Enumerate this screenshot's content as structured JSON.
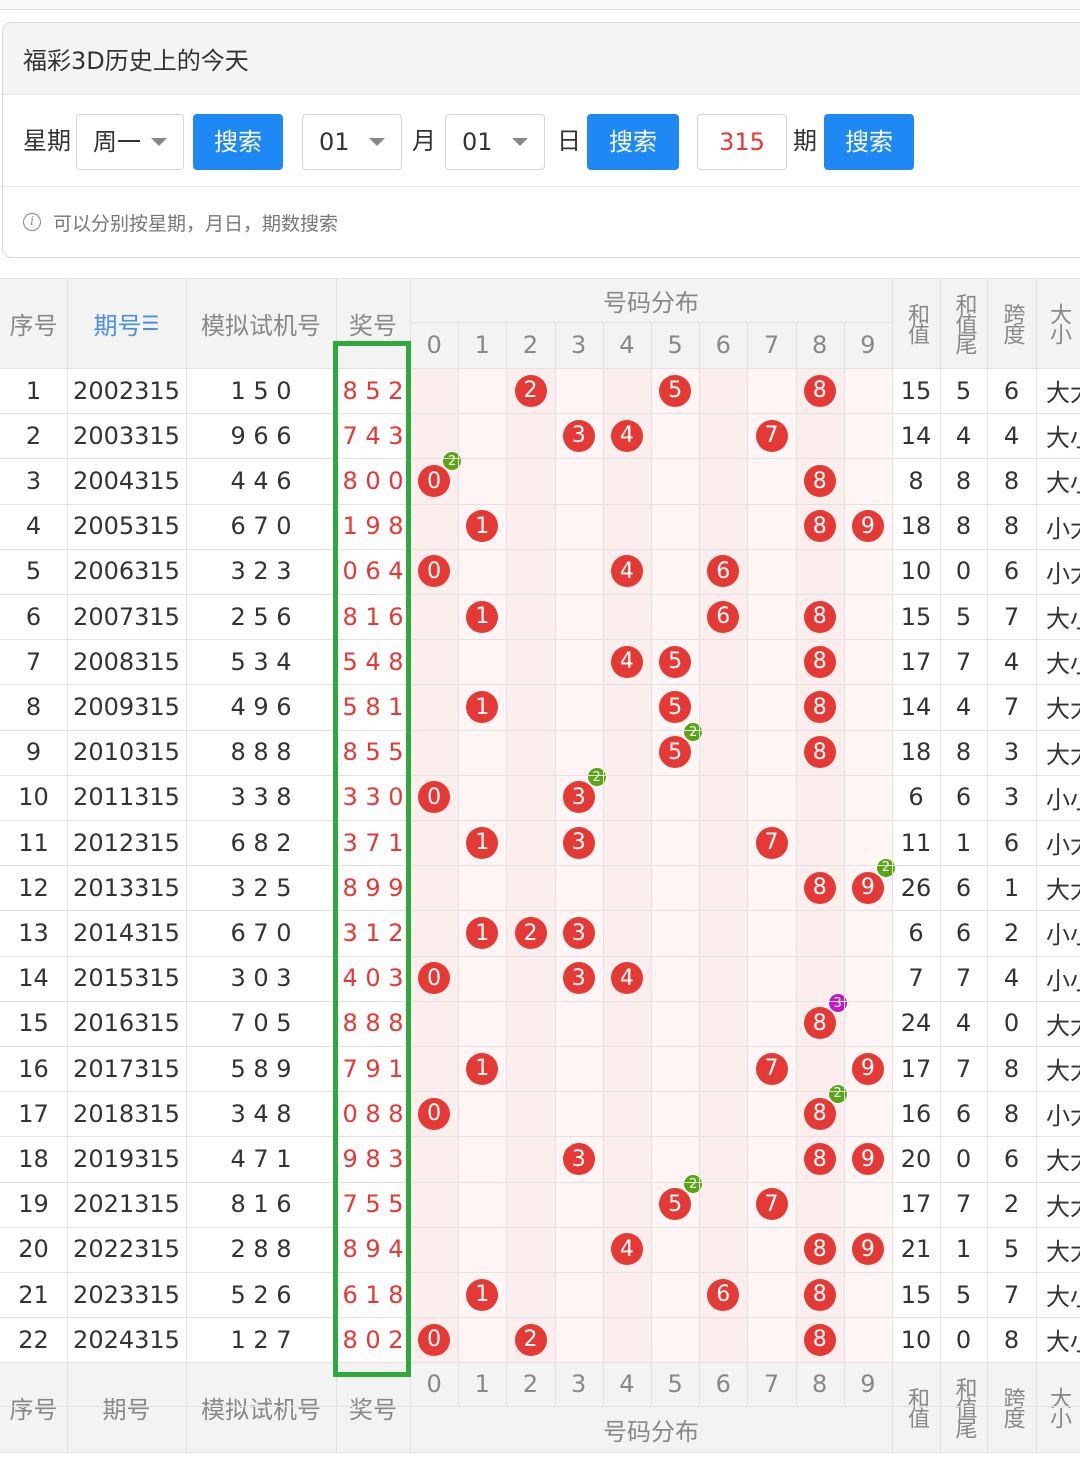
{
  "panel": {
    "title": "福彩3D历史上的今天",
    "weekday_label": "星期",
    "weekday_value": "周一",
    "search_label": "搜索",
    "month_value": "01",
    "month_label": "月",
    "day_value": "01",
    "day_label": "日",
    "issue_value": "315",
    "issue_label": "期",
    "tip": "可以分别按星期，月日，期数搜索"
  },
  "table": {
    "headers": {
      "seq": "序号",
      "issue": "期号",
      "sim": "模拟试机号",
      "prize": "奖号",
      "dist": "号码分布",
      "sum": "和值",
      "sum_tail": "和值尾",
      "span": "跨度",
      "size": "大小"
    },
    "digits": [
      "0",
      "1",
      "2",
      "3",
      "4",
      "5",
      "6",
      "7",
      "8",
      "9"
    ],
    "rows": [
      {
        "seq": "1",
        "issue": "2002315",
        "sim": "1 5 0",
        "prize": "8 5 2",
        "sum": "15",
        "tail": "5",
        "span": "6",
        "size": "大大小"
      },
      {
        "seq": "2",
        "issue": "2003315",
        "sim": "9 6 6",
        "prize": "7 4 3",
        "sum": "14",
        "tail": "4",
        "span": "4",
        "size": "大小小"
      },
      {
        "seq": "3",
        "issue": "2004315",
        "sim": "4 4 6",
        "prize": "8 0 0",
        "sum": "8",
        "tail": "8",
        "span": "8",
        "size": "大小小"
      },
      {
        "seq": "4",
        "issue": "2005315",
        "sim": "6 7 0",
        "prize": "1 9 8",
        "sum": "18",
        "tail": "8",
        "span": "8",
        "size": "小大大"
      },
      {
        "seq": "5",
        "issue": "2006315",
        "sim": "3 2 3",
        "prize": "0 6 4",
        "sum": "10",
        "tail": "0",
        "span": "6",
        "size": "小大小"
      },
      {
        "seq": "6",
        "issue": "2007315",
        "sim": "2 5 6",
        "prize": "8 1 6",
        "sum": "15",
        "tail": "5",
        "span": "7",
        "size": "大小大"
      },
      {
        "seq": "7",
        "issue": "2008315",
        "sim": "5 3 4",
        "prize": "5 4 8",
        "sum": "17",
        "tail": "7",
        "span": "4",
        "size": "大小大"
      },
      {
        "seq": "8",
        "issue": "2009315",
        "sim": "4 9 6",
        "prize": "5 8 1",
        "sum": "14",
        "tail": "4",
        "span": "7",
        "size": "大大小"
      },
      {
        "seq": "9",
        "issue": "2010315",
        "sim": "8 8 8",
        "prize": "8 5 5",
        "sum": "18",
        "tail": "8",
        "span": "3",
        "size": "大大大"
      },
      {
        "seq": "10",
        "issue": "2011315",
        "sim": "3 3 8",
        "prize": "3 3 0",
        "sum": "6",
        "tail": "6",
        "span": "3",
        "size": "小小小"
      },
      {
        "seq": "11",
        "issue": "2012315",
        "sim": "6 8 2",
        "prize": "3 7 1",
        "sum": "11",
        "tail": "1",
        "span": "6",
        "size": "小大小"
      },
      {
        "seq": "12",
        "issue": "2013315",
        "sim": "3 2 5",
        "prize": "8 9 9",
        "sum": "26",
        "tail": "6",
        "span": "1",
        "size": "大大大"
      },
      {
        "seq": "13",
        "issue": "2014315",
        "sim": "6 7 0",
        "prize": "3 1 2",
        "sum": "6",
        "tail": "6",
        "span": "2",
        "size": "小小小"
      },
      {
        "seq": "14",
        "issue": "2015315",
        "sim": "3 0 3",
        "prize": "4 0 3",
        "sum": "7",
        "tail": "7",
        "span": "4",
        "size": "小小小"
      },
      {
        "seq": "15",
        "issue": "2016315",
        "sim": "7 0 5",
        "prize": "8 8 8",
        "sum": "24",
        "tail": "4",
        "span": "0",
        "size": "大大大"
      },
      {
        "seq": "16",
        "issue": "2017315",
        "sim": "5 8 9",
        "prize": "7 9 1",
        "sum": "17",
        "tail": "7",
        "span": "8",
        "size": "大大小"
      },
      {
        "seq": "17",
        "issue": "2018315",
        "sim": "3 4 8",
        "prize": "0 8 8",
        "sum": "16",
        "tail": "6",
        "span": "8",
        "size": "小大大"
      },
      {
        "seq": "18",
        "issue": "2019315",
        "sim": "4 7 1",
        "prize": "9 8 3",
        "sum": "20",
        "tail": "0",
        "span": "6",
        "size": "大大小"
      },
      {
        "seq": "19",
        "issue": "2021315",
        "sim": "8 1 6",
        "prize": "7 5 5",
        "sum": "17",
        "tail": "7",
        "span": "2",
        "size": "大大大"
      },
      {
        "seq": "20",
        "issue": "2022315",
        "sim": "2 8 8",
        "prize": "8 9 4",
        "sum": "21",
        "tail": "1",
        "span": "5",
        "size": "大大小"
      },
      {
        "seq": "21",
        "issue": "2023315",
        "sim": "5 2 6",
        "prize": "6 1 8",
        "sum": "15",
        "tail": "5",
        "span": "7",
        "size": "大小大"
      },
      {
        "seq": "22",
        "issue": "2024315",
        "sim": "1 2 7",
        "prize": "8 0 2",
        "sum": "10",
        "tail": "0",
        "span": "8",
        "size": "大小小"
      }
    ],
    "dist": [
      {
        "balls": [
          "2",
          "5",
          "8"
        ]
      },
      {
        "balls": [
          "3",
          "4",
          "7"
        ]
      },
      {
        "balls": [
          "0",
          "8"
        ],
        "badge": {
          "digit": "0",
          "count": "2",
          "color": "#5aa514"
        }
      },
      {
        "balls": [
          "1",
          "8",
          "9"
        ]
      },
      {
        "balls": [
          "0",
          "4",
          "6"
        ]
      },
      {
        "balls": [
          "1",
          "6",
          "8"
        ]
      },
      {
        "balls": [
          "4",
          "5",
          "8"
        ]
      },
      {
        "balls": [
          "1",
          "5",
          "8"
        ]
      },
      {
        "balls": [
          "5",
          "8"
        ],
        "badge": {
          "digit": "5",
          "count": "2",
          "color": "#5aa514"
        }
      },
      {
        "balls": [
          "0",
          "3"
        ],
        "badge": {
          "digit": "3",
          "count": "2",
          "color": "#5aa514"
        }
      },
      {
        "balls": [
          "1",
          "3",
          "7"
        ]
      },
      {
        "balls": [
          "8",
          "9"
        ],
        "badge": {
          "digit": "9",
          "count": "2",
          "color": "#5aa514"
        }
      },
      {
        "balls": [
          "1",
          "2",
          "3"
        ]
      },
      {
        "balls": [
          "0",
          "3",
          "4"
        ]
      },
      {
        "balls": [
          "8"
        ],
        "badge": {
          "digit": "8",
          "count": "3",
          "color": "#c218c8"
        }
      },
      {
        "balls": [
          "1",
          "7",
          "9"
        ]
      },
      {
        "balls": [
          "0",
          "8"
        ],
        "badge": {
          "digit": "8",
          "count": "2",
          "color": "#5aa514"
        }
      },
      {
        "balls": [
          "3",
          "8",
          "9"
        ]
      },
      {
        "balls": [
          "5",
          "7"
        ],
        "badge": {
          "digit": "5",
          "count": "2",
          "color": "#5aa514"
        }
      },
      {
        "balls": [
          "4",
          "8",
          "9"
        ]
      },
      {
        "balls": [
          "1",
          "6",
          "8"
        ]
      },
      {
        "balls": [
          "0",
          "2",
          "8"
        ]
      }
    ]
  },
  "colors": {
    "accent": "#1e88f5",
    "ball": "#e53935",
    "highlight": "#2eaa3c",
    "prize_text": "#e53935"
  }
}
